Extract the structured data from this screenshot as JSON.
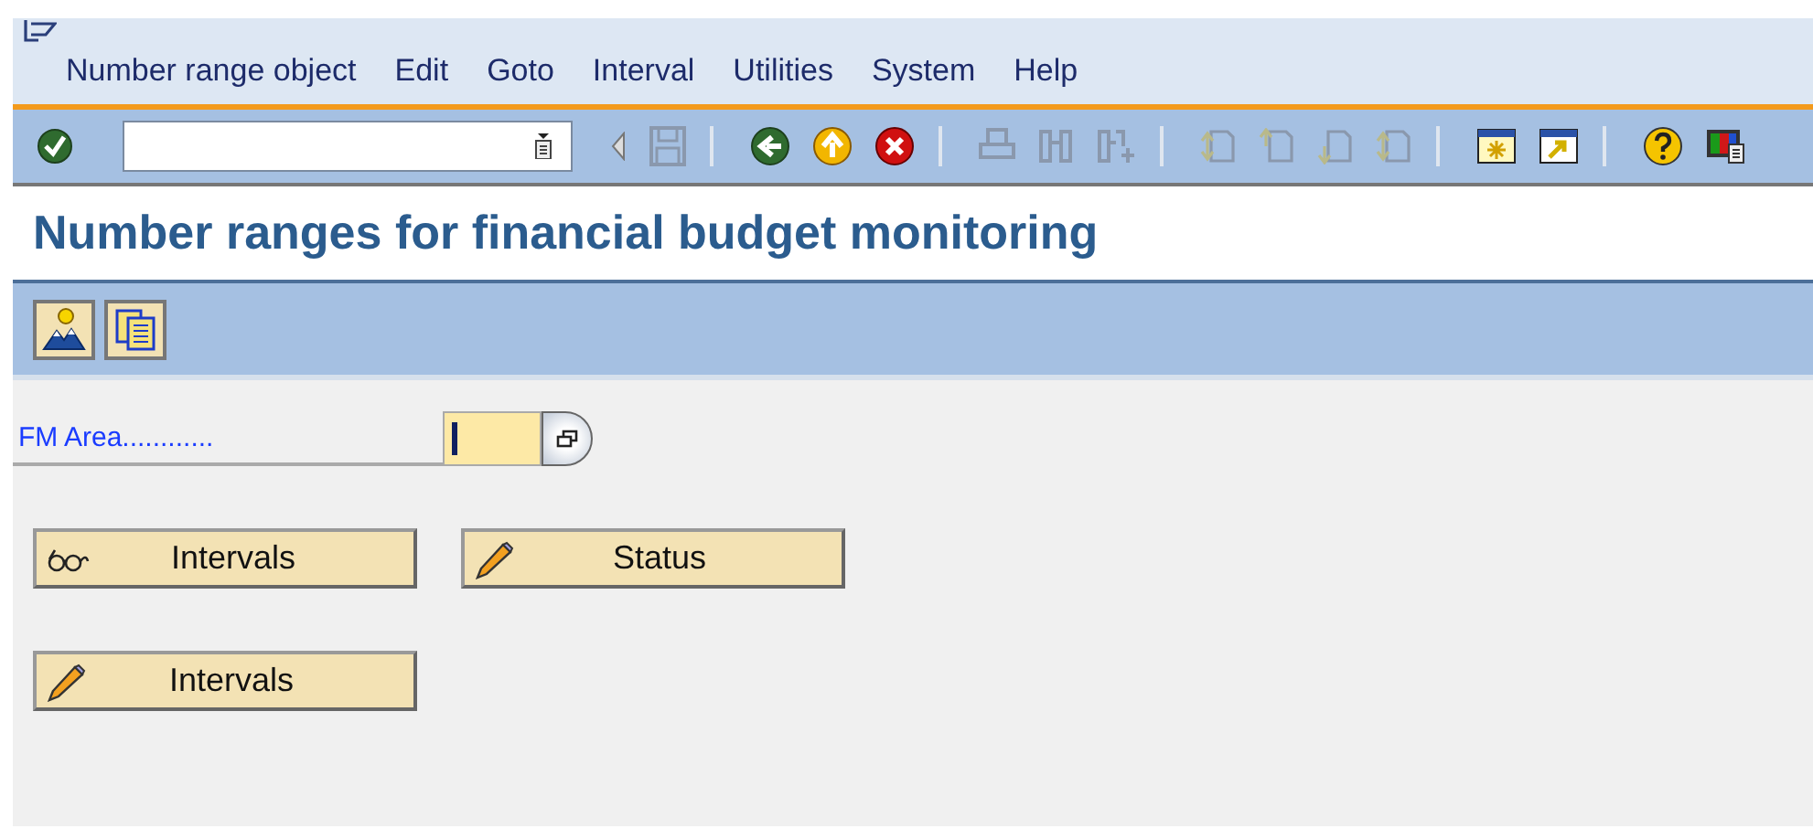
{
  "menu_bar": [
    {
      "label": "Number range object"
    },
    {
      "label": "Edit"
    },
    {
      "label": "Goto"
    },
    {
      "label": "Interval"
    },
    {
      "label": "Utilities"
    },
    {
      "label": "System"
    },
    {
      "label": "Help"
    }
  ],
  "window": {
    "title": "Number ranges for financial budget monitoring"
  },
  "form": {
    "label": "FM Area............"
  },
  "button_rows": [
    [
      {
        "label": "Intervals",
        "kind": "display"
      },
      {
        "label": "Status",
        "kind": "change"
      }
    ],
    [
      {
        "label": "Intervals",
        "kind": "change"
      }
    ]
  ]
}
